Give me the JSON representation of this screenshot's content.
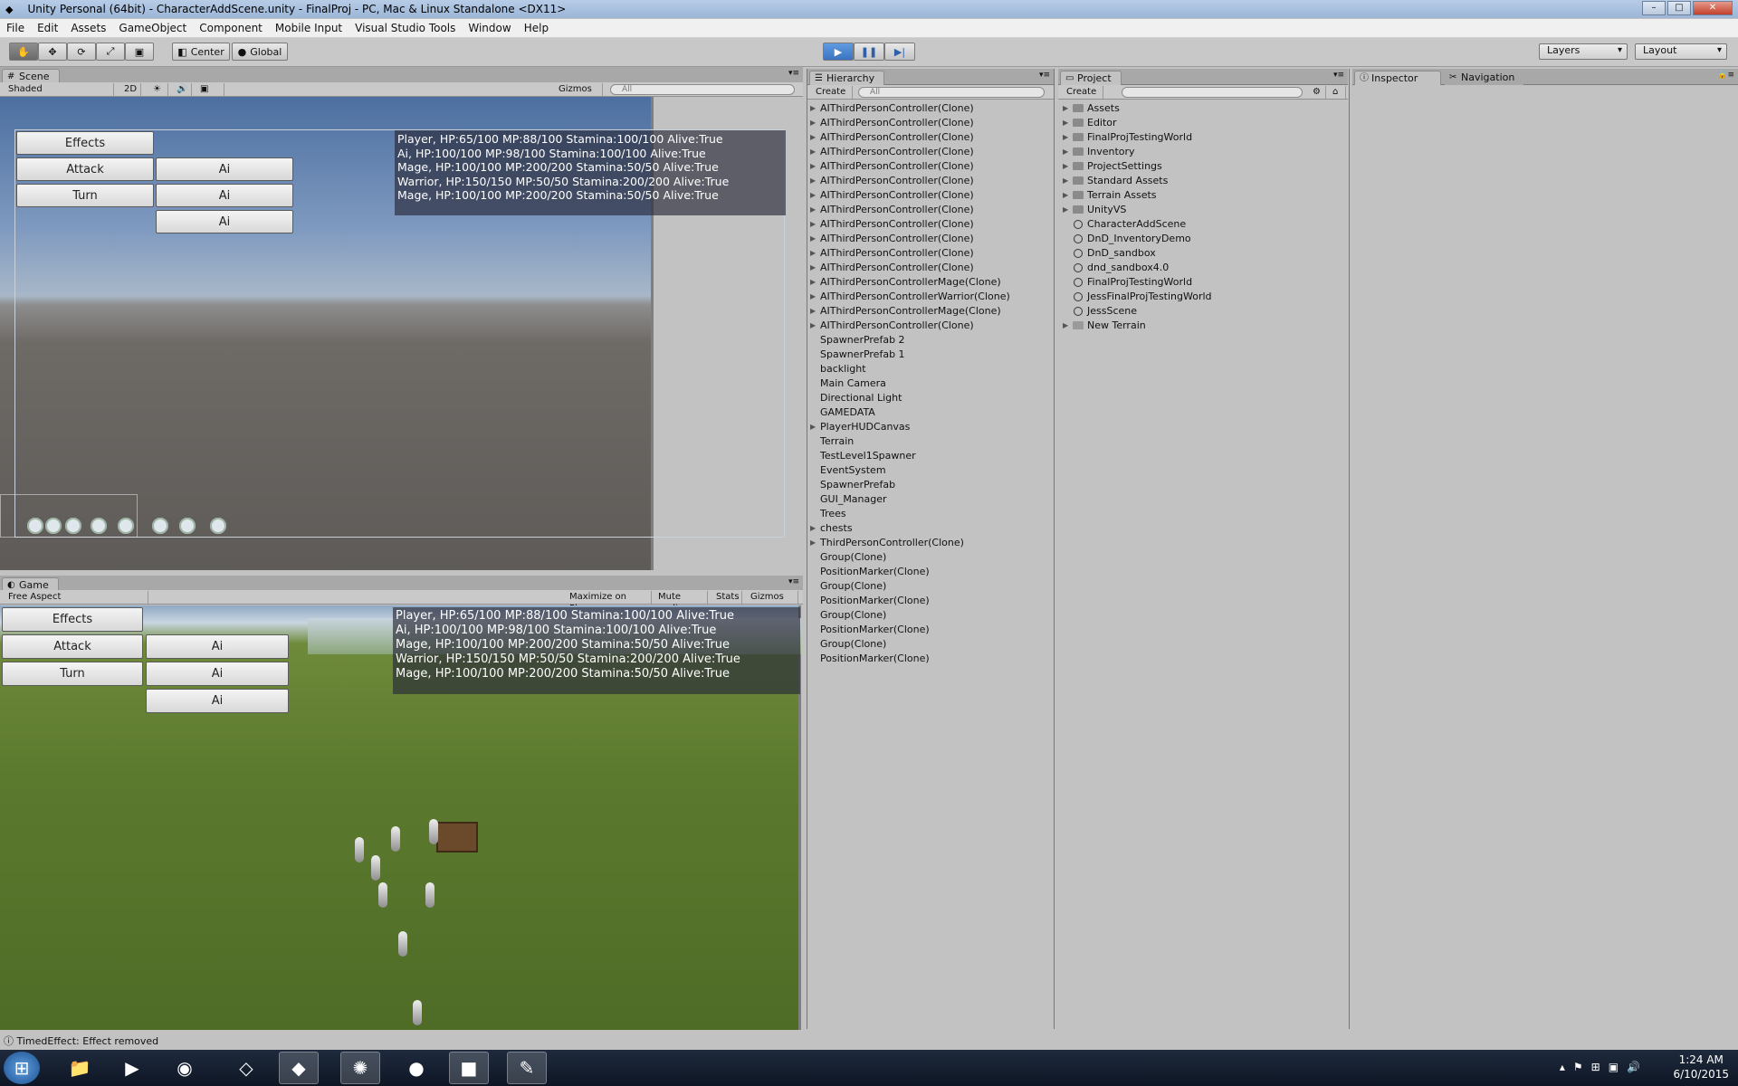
{
  "window": {
    "title": "Unity Personal (64bit) - CharacterAddScene.unity - FinalProj - PC, Mac & Linux Standalone <DX11>",
    "minimize": "–",
    "maximize": "□",
    "close": "✕"
  },
  "menu": [
    "File",
    "Edit",
    "Assets",
    "GameObject",
    "Component",
    "Mobile Input",
    "Visual Studio Tools",
    "Window",
    "Help"
  ],
  "toolbar": {
    "center": "Center",
    "global": "Global",
    "layers": "Layers",
    "layout": "Layout",
    "hand_icon": "✋",
    "move_icon": "✥",
    "rotate_icon": "⟳",
    "scale_icon": "⤢",
    "rect_icon": "▣",
    "play_icon": "▶",
    "pause_icon": "❚❚",
    "step_icon": "▶|"
  },
  "scene": {
    "tab": "Scene",
    "shading": "Shaded",
    "mode2d": "2D",
    "gizmos": "Gizmos",
    "search": "All",
    "sun_icon": "☀",
    "audio_icon": "🔊",
    "image_icon": "▣"
  },
  "game": {
    "tab": "Game",
    "aspect": "Free Aspect",
    "maximize": "Maximize on Play",
    "mute": "Mute audio",
    "stats": "Stats",
    "gizmos": "Gizmos"
  },
  "hud": {
    "effects": "Effects",
    "attack": "Attack",
    "turn": "Turn",
    "ai": "Ai",
    "lines": [
      "Player, HP:65/100 MP:88/100 Stamina:100/100 Alive:True",
      "Ai, HP:100/100 MP:98/100 Stamina:100/100 Alive:True",
      "Mage, HP:100/100 MP:200/200 Stamina:50/50 Alive:True",
      "Warrior, HP:150/150 MP:50/50 Stamina:200/200 Alive:True",
      "Mage, HP:100/100 MP:200/200 Stamina:50/50 Alive:True"
    ]
  },
  "hierarchy": {
    "tab": "Hierarchy",
    "create": "Create",
    "search": "All",
    "items": [
      {
        "label": "AIThirdPersonController(Clone)",
        "arrow": true
      },
      {
        "label": "AIThirdPersonController(Clone)",
        "arrow": true
      },
      {
        "label": "AIThirdPersonController(Clone)",
        "arrow": true
      },
      {
        "label": "AIThirdPersonController(Clone)",
        "arrow": true
      },
      {
        "label": "AIThirdPersonController(Clone)",
        "arrow": true
      },
      {
        "label": "AIThirdPersonController(Clone)",
        "arrow": true
      },
      {
        "label": "AIThirdPersonController(Clone)",
        "arrow": true
      },
      {
        "label": "AIThirdPersonController(Clone)",
        "arrow": true
      },
      {
        "label": "AIThirdPersonController(Clone)",
        "arrow": true
      },
      {
        "label": "AIThirdPersonController(Clone)",
        "arrow": true
      },
      {
        "label": "AIThirdPersonController(Clone)",
        "arrow": true
      },
      {
        "label": "AIThirdPersonController(Clone)",
        "arrow": true
      },
      {
        "label": "AIThirdPersonControllerMage(Clone)",
        "arrow": true
      },
      {
        "label": "AIThirdPersonControllerWarrior(Clone)",
        "arrow": true
      },
      {
        "label": "AIThirdPersonControllerMage(Clone)",
        "arrow": true
      },
      {
        "label": "AIThirdPersonController(Clone)",
        "arrow": true
      },
      {
        "label": "SpawnerPrefab 2",
        "arrow": false
      },
      {
        "label": "SpawnerPrefab 1",
        "arrow": false
      },
      {
        "label": "backlight",
        "arrow": false
      },
      {
        "label": "Main Camera",
        "arrow": false
      },
      {
        "label": "Directional Light",
        "arrow": false
      },
      {
        "label": "GAMEDATA",
        "arrow": false
      },
      {
        "label": "PlayerHUDCanvas",
        "arrow": true
      },
      {
        "label": "Terrain",
        "arrow": false
      },
      {
        "label": "TestLevel1Spawner",
        "arrow": false
      },
      {
        "label": "EventSystem",
        "arrow": false
      },
      {
        "label": "SpawnerPrefab",
        "arrow": false
      },
      {
        "label": "GUI_Manager",
        "arrow": false
      },
      {
        "label": "Trees",
        "arrow": false
      },
      {
        "label": "chests",
        "arrow": true
      },
      {
        "label": "ThirdPersonController(Clone)",
        "arrow": true
      },
      {
        "label": "Group(Clone)",
        "arrow": false
      },
      {
        "label": "PositionMarker(Clone)",
        "arrow": false
      },
      {
        "label": "Group(Clone)",
        "arrow": false
      },
      {
        "label": "PositionMarker(Clone)",
        "arrow": false
      },
      {
        "label": "Group(Clone)",
        "arrow": false
      },
      {
        "label": "PositionMarker(Clone)",
        "arrow": false
      },
      {
        "label": "Group(Clone)",
        "arrow": false
      },
      {
        "label": "PositionMarker(Clone)",
        "arrow": false
      }
    ]
  },
  "project": {
    "tab": "Project",
    "create": "Create",
    "items": [
      {
        "label": "Assets",
        "kind": "folder",
        "arrow": true
      },
      {
        "label": "Editor",
        "kind": "folder",
        "arrow": true
      },
      {
        "label": "FinalProjTestingWorld",
        "kind": "folder",
        "arrow": true
      },
      {
        "label": "Inventory",
        "kind": "folder",
        "arrow": true
      },
      {
        "label": "ProjectSettings",
        "kind": "folder",
        "arrow": true
      },
      {
        "label": "Standard Assets",
        "kind": "folder",
        "arrow": true
      },
      {
        "label": "Terrain Assets",
        "kind": "folder",
        "arrow": true
      },
      {
        "label": "UnityVS",
        "kind": "folder",
        "arrow": true
      },
      {
        "label": "CharacterAddScene",
        "kind": "scene",
        "arrow": false
      },
      {
        "label": "DnD_InventoryDemo",
        "kind": "scene",
        "arrow": false
      },
      {
        "label": "DnD_sandbox",
        "kind": "scene",
        "arrow": false
      },
      {
        "label": "dnd_sandbox4.0",
        "kind": "scene",
        "arrow": false
      },
      {
        "label": "FinalProjTestingWorld",
        "kind": "scene",
        "arrow": false
      },
      {
        "label": "JessFinalProjTestingWorld",
        "kind": "scene",
        "arrow": false
      },
      {
        "label": "JessScene",
        "kind": "scene",
        "arrow": false
      },
      {
        "label": "New Terrain",
        "kind": "terrain",
        "arrow": true
      }
    ]
  },
  "inspector": {
    "tab": "Inspector",
    "nav_tab": "Navigation"
  },
  "status": "TimedEffect: Effect removed",
  "taskbar": {
    "time": "1:24 AM",
    "date": "6/10/2015"
  }
}
